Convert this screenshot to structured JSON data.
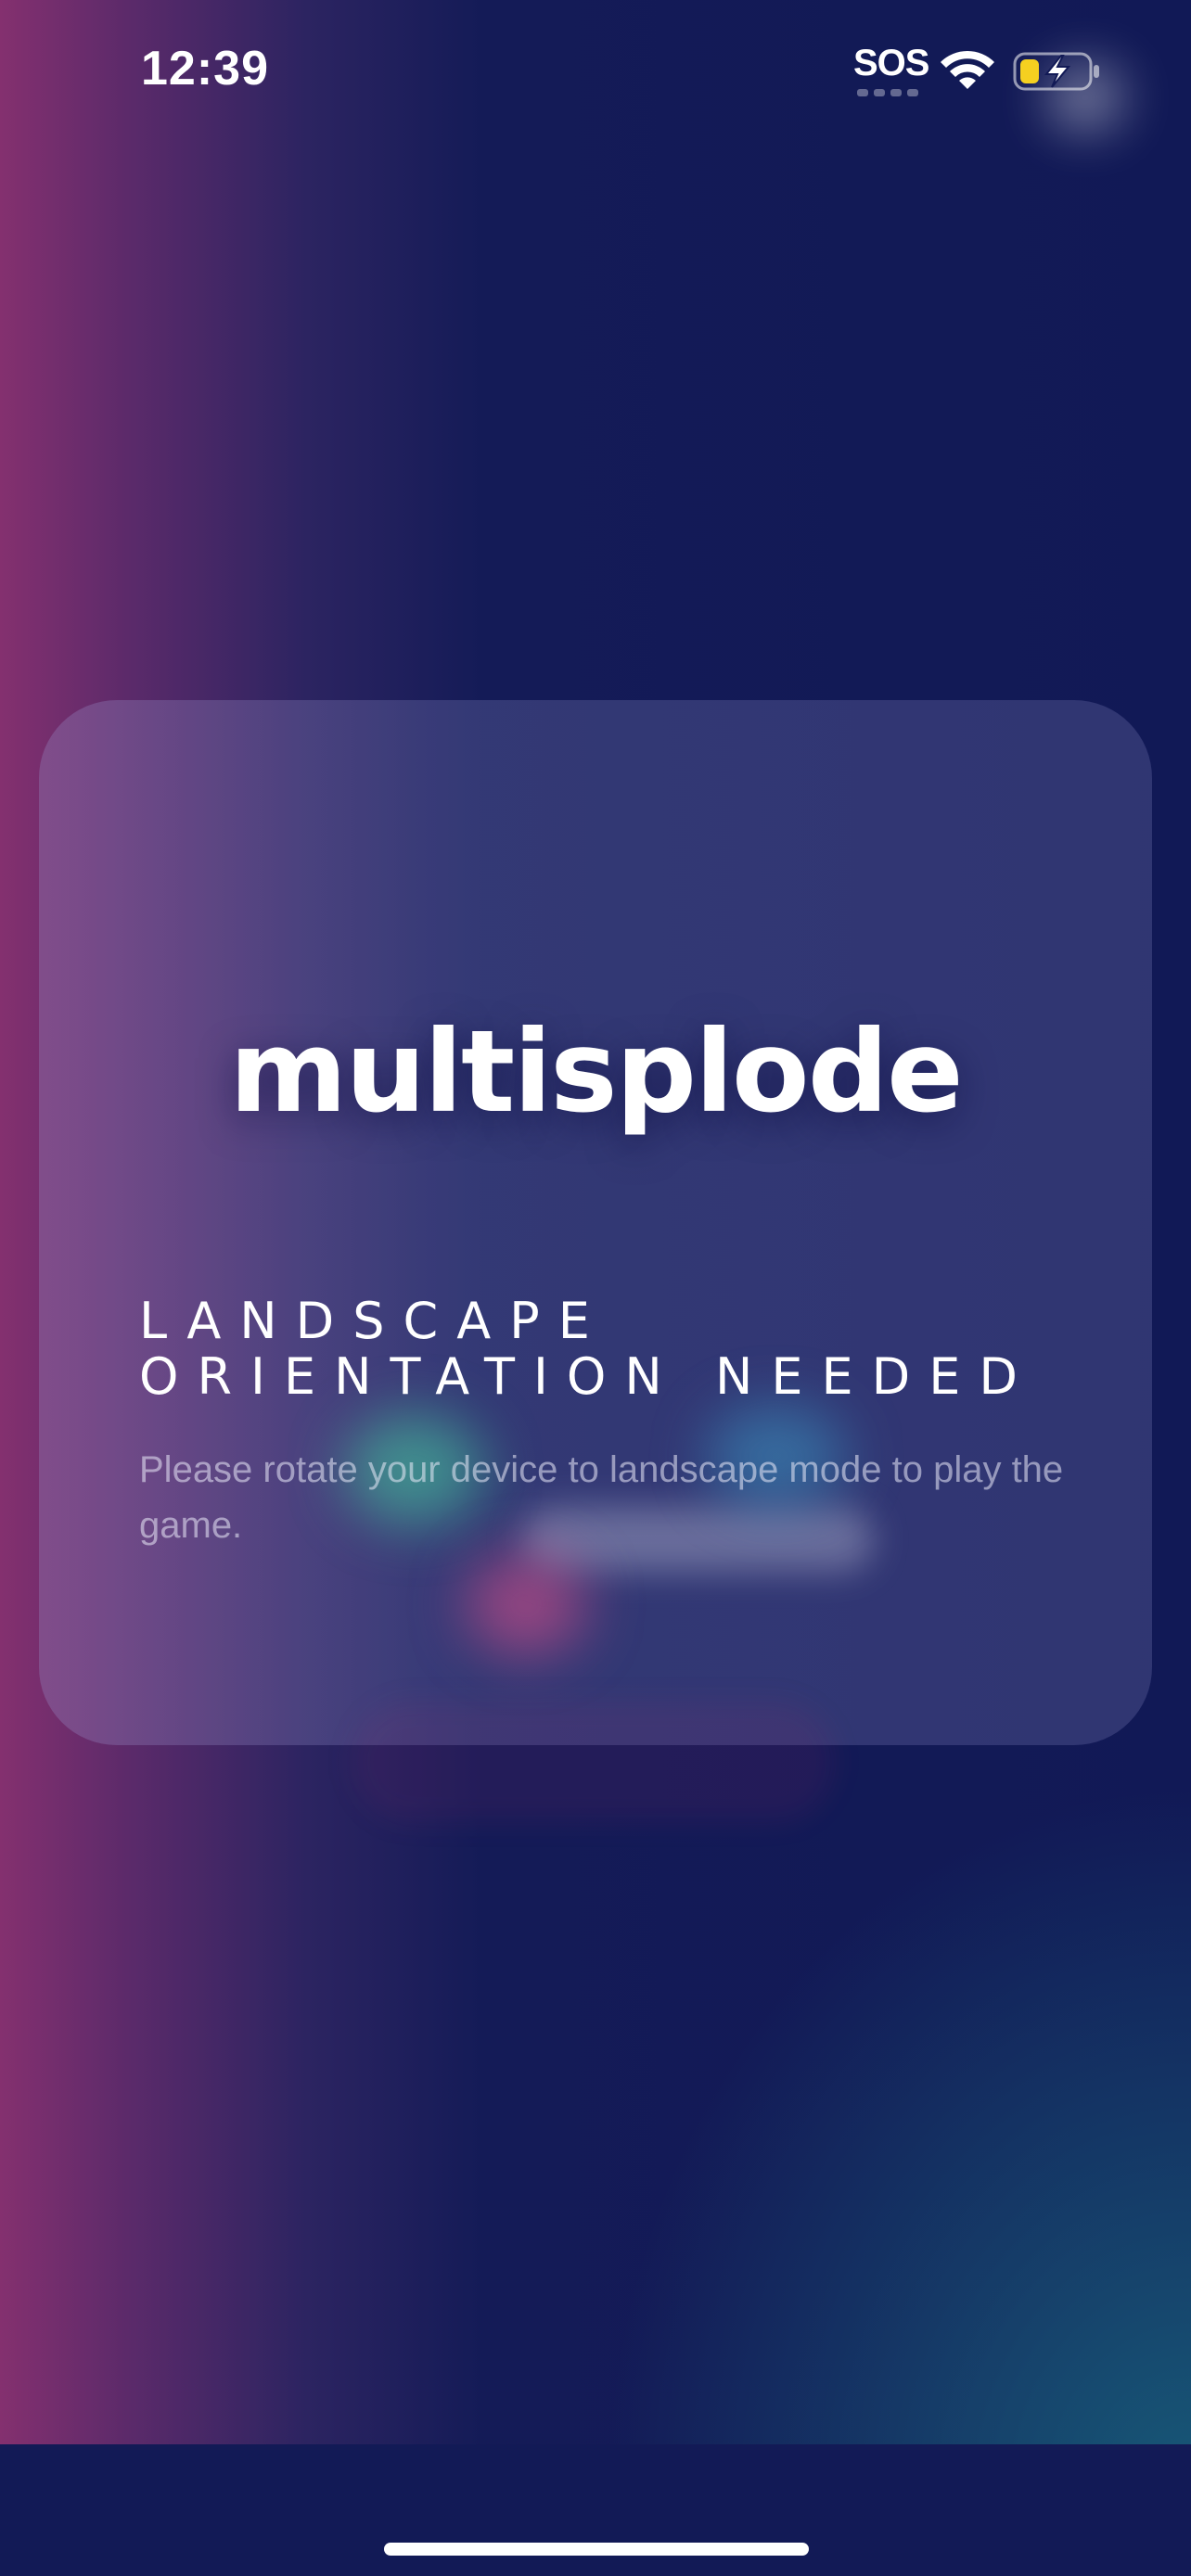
{
  "status_bar": {
    "time": "12:39",
    "sos": "SOS",
    "icons": [
      "wifi-icon",
      "battery-charging-icon"
    ],
    "battery_fill_fraction": 0.3,
    "battery_color": "#f5d020"
  },
  "card": {
    "game_title": "multisplode",
    "heading_line1": "LANDSCAPE",
    "heading_line2": "ORIENTATION NEEDED",
    "message": "Please rotate your device to landscape mode to play the game."
  },
  "colors": {
    "background_navy": "#121a56",
    "accent_magenta": "#84306f",
    "accent_teal": "#1a6e82"
  }
}
